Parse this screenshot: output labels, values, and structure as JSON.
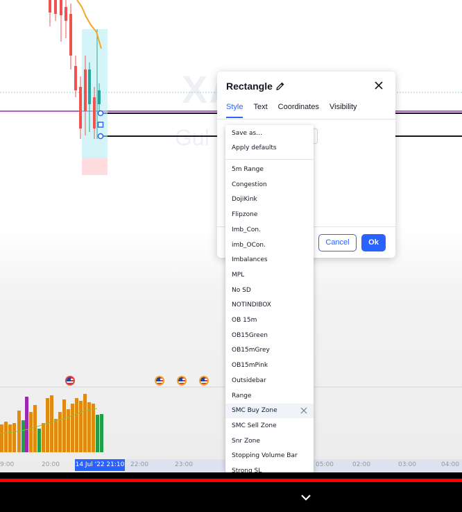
{
  "chart": {
    "watermark_symbol": "XA",
    "watermark_name": "Gul",
    "time_axis": {
      "labels": [
        "9:00",
        "20:00",
        "22:00",
        "23:00",
        "02:00",
        "03:00",
        "04:00",
        "05:00"
      ],
      "selected": "14 Jul '22   21:10"
    },
    "colors": {
      "bull": "#26a69a",
      "bear": "#ef5350",
      "ma": "#f5a623",
      "level_purple": "#9c27b0",
      "level_black": "#131722",
      "volume_orange": "#e08a12",
      "volume_green": "#22a049",
      "volume_purple": "#9c27b0"
    }
  },
  "dialog": {
    "title": "Rectangle",
    "tabs": [
      "Style",
      "Text",
      "Coordinates",
      "Visibility"
    ],
    "active_tab": "Style",
    "cancel_label": "Cancel",
    "ok_label": "Ok",
    "accent": "#2962ff"
  },
  "template_menu": {
    "actions": [
      "Save as…",
      "Apply defaults"
    ],
    "templates": [
      "5m Range",
      "Congestion",
      "DojiKink",
      "Flipzone",
      "Imb_Con.",
      "imb_OCon.",
      "Imbalances",
      "MPL",
      "No SD",
      "NOTINDIBOX",
      "OB 15m",
      "OB15Green",
      "OB15mGrey",
      "OB15mPink",
      "Outsidebar",
      "Range",
      "SMC Buy Zone",
      "SMC Sell Zone",
      "Snr Zone",
      "Stopping Volume Bar",
      "Strong SL"
    ],
    "hovered": "SMC Buy Zone"
  },
  "player": {
    "progress_color": "#ff0000"
  }
}
